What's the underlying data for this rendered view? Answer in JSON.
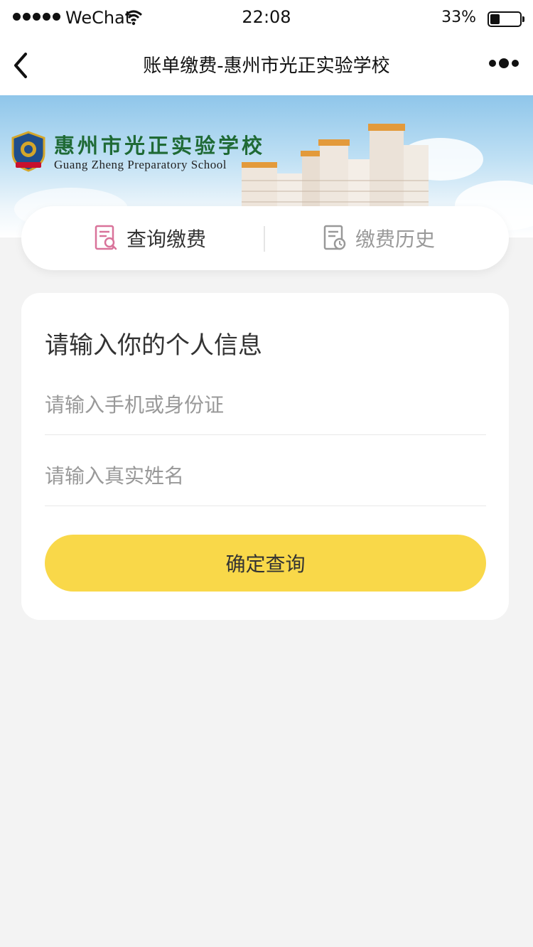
{
  "status_bar": {
    "carrier": "WeChat",
    "time": "22:08",
    "battery_percent": "33%",
    "battery_level": 0.33,
    "icons": [
      "signal-dots",
      "wifi-icon",
      "battery-icon"
    ]
  },
  "nav": {
    "title": "账单缴费-惠州市光正实验学校",
    "icons": [
      "chevron-left-icon",
      "more-dots-icon"
    ]
  },
  "banner": {
    "school_name_cn": "惠州市光正实验学校",
    "school_name_en": "Guang Zheng Preparatory School"
  },
  "tabs": [
    {
      "label": "查询缴费",
      "icon": "document-search-icon",
      "active": true
    },
    {
      "label": "缴费历史",
      "icon": "document-clock-icon",
      "active": false
    }
  ],
  "form": {
    "title": "请输入你的个人信息",
    "phone_placeholder": "请输入手机或身份证",
    "phone_value": "",
    "name_placeholder": "请输入真实姓名",
    "name_value": "",
    "submit_label": "确定查询"
  },
  "colors": {
    "accent_yellow": "#f9d849",
    "page_background": "#f3f3f3",
    "active_tab_icon": "#d9739a",
    "inactive_tab_text": "#999999",
    "school_name_green": "#1f6a35"
  }
}
